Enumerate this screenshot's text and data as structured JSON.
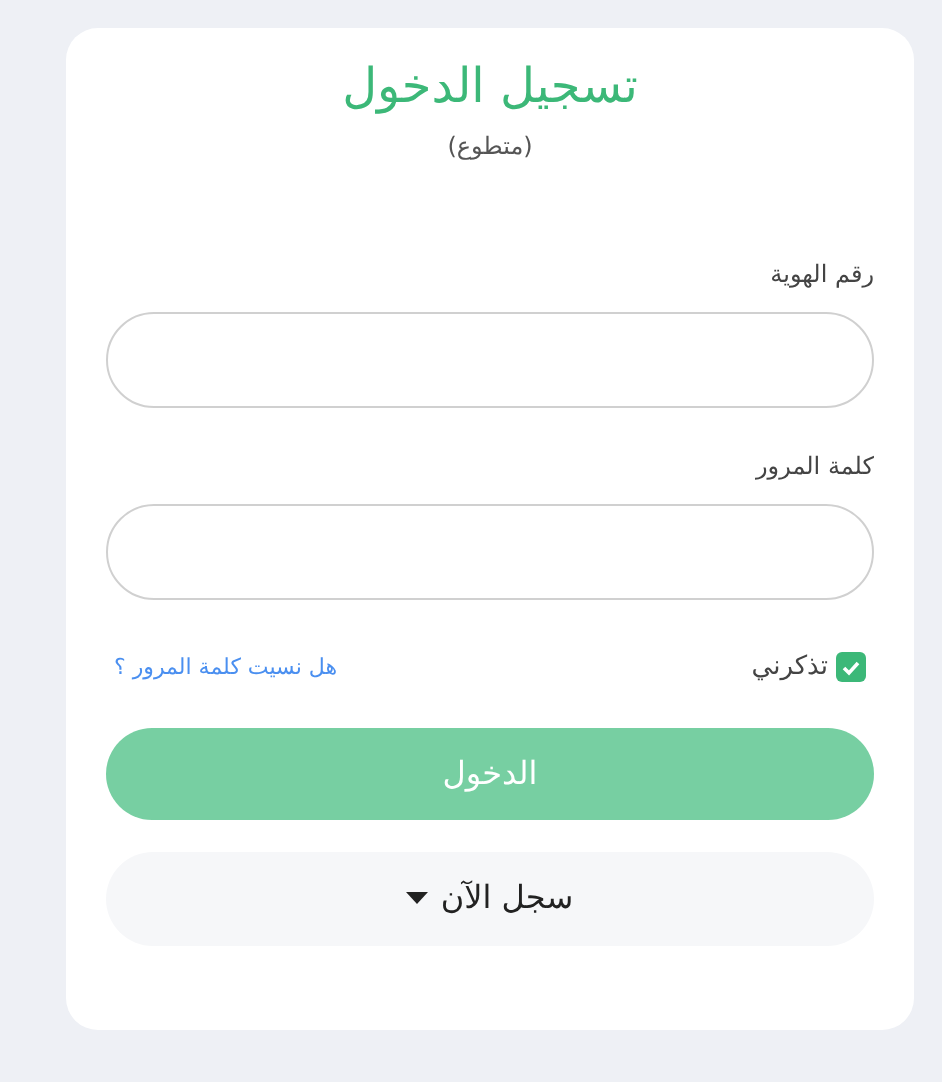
{
  "title": "تسجيل الدخول",
  "subtitle": "(متطوع)",
  "fields": [
    {
      "label": "رقم الهوية"
    },
    {
      "label": "كلمة المرور"
    }
  ],
  "remember": {
    "label": "تذكرني",
    "checked": true
  },
  "forgot_link": "هل نسيت كلمة المرور ؟",
  "login_button": {
    "label": "الدخول",
    "disabled": true
  },
  "register_button": {
    "label": "سجل الآن",
    "expanded": false
  }
}
